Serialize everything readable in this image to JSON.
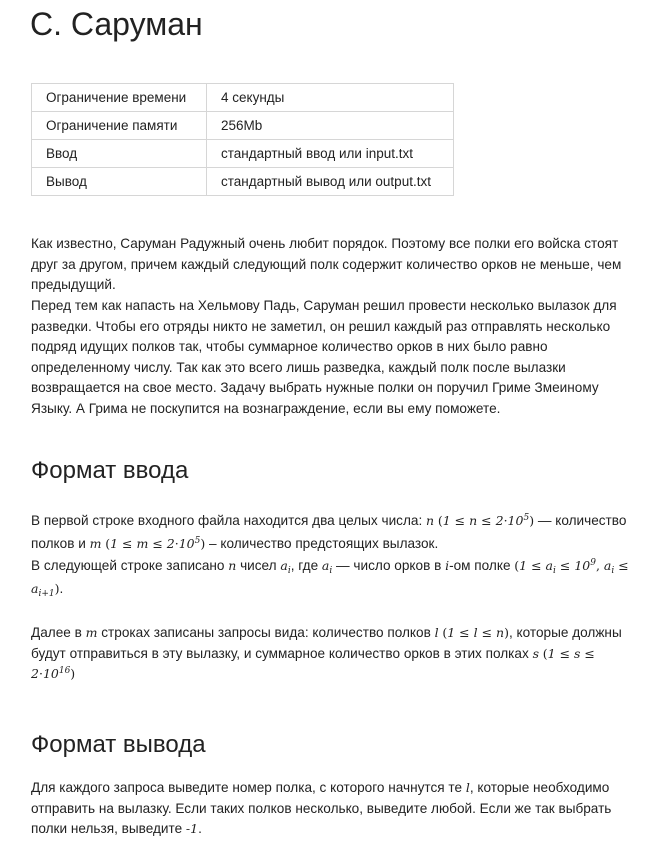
{
  "title": "C. Саруман",
  "limits": [
    {
      "label": "Ограничение времени",
      "value": "4 секунды"
    },
    {
      "label": "Ограничение памяти",
      "value": "256Mb"
    },
    {
      "label": "Ввод",
      "value": "стандартный ввод или input.txt"
    },
    {
      "label": "Вывод",
      "value": "стандартный вывод или output.txt"
    }
  ],
  "statement": {
    "p1": "Как известно, Саруман Радужный очень любит порядок. Поэтому все полки его войска стоят друг за другом, причем каждый следующий полк содержит количество орков не меньше, чем предыдущий.",
    "p2": "Перед тем как напасть на Хельмову Падь, Саруман решил провести несколько вылазок для разведки. Чтобы его отряды никто не заметил, он решил каждый раз отправлять несколько подряд идущих полков так, чтобы суммарное количество орков в них было равно определенному числу. Так как это всего лишь разведка, каждый полк после вылазки возвращается на свое место. Задачу выбрать нужные полки он поручил Гриме Змеиному Языку. А Грима не поскупится на вознаграждение, если вы ему поможете."
  },
  "input_format": {
    "heading": "Формат ввода",
    "l1a": "В первой строке входного файла находится два целых числа: ",
    "l1b": " — количество полков и ",
    "l1c": " – количество предстоящих вылазок.",
    "l2a": "В следующей строке записано ",
    "l2b": " чисел ",
    "l2c": ", где ",
    "l2d": " — число орков в ",
    "l2e": "-ом полке ",
    "l3a": "Далее в ",
    "l3b": " строках записаны запросы вида: количество полков ",
    "l3c": ", которые должны будут отправиться в эту вылазку, и суммарное количество орков в этих полках "
  },
  "output_format": {
    "heading": "Формат вывода",
    "a": "Для каждого запроса выведите номер полка, с которого начнутся те ",
    "b": ", которые необходимо отправить на вылазку. Если таких полков несколько, выведите любой. Если же так выбрать полки нельзя, выведите ",
    "c": "."
  }
}
